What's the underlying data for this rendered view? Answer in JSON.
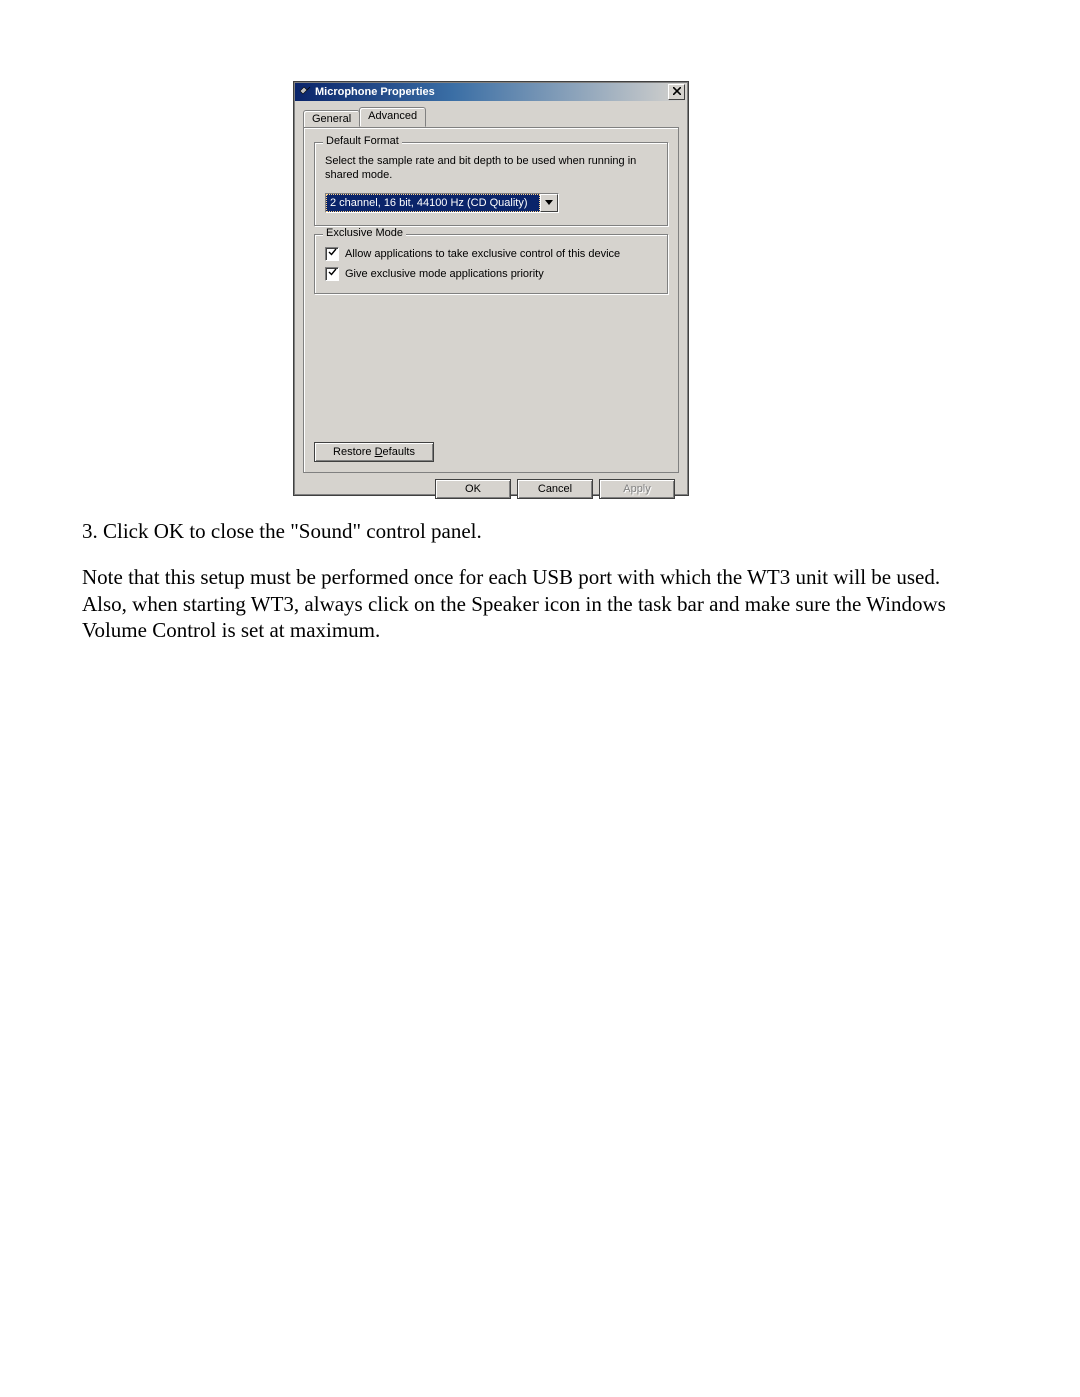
{
  "dialog": {
    "title": "Microphone Properties",
    "tabs": {
      "general": "General",
      "advanced": "Advanced"
    },
    "groups": {
      "default_format": {
        "legend": "Default Format",
        "desc": "Select the sample rate and bit depth to be used when running in shared mode.",
        "selected": "2 channel, 16 bit, 44100 Hz (CD Quality)"
      },
      "exclusive_mode": {
        "legend": "Exclusive Mode",
        "opt_allow": "Allow applications to take exclusive control of this device",
        "opt_priority": "Give exclusive mode applications priority"
      }
    },
    "buttons": {
      "restore_pre": "Restore ",
      "restore_u": "D",
      "restore_post": "efaults",
      "ok": "OK",
      "cancel": "Cancel",
      "apply": "Apply"
    }
  },
  "document": {
    "step3": "3. Click OK to close the \"Sound\" control panel.",
    "note": "Note that this setup must be performed once for each USB port with which the WT3 unit will be used. Also, when starting WT3, always click on the Speaker icon in the task bar and make sure the Windows Volume Control is set at maximum."
  }
}
